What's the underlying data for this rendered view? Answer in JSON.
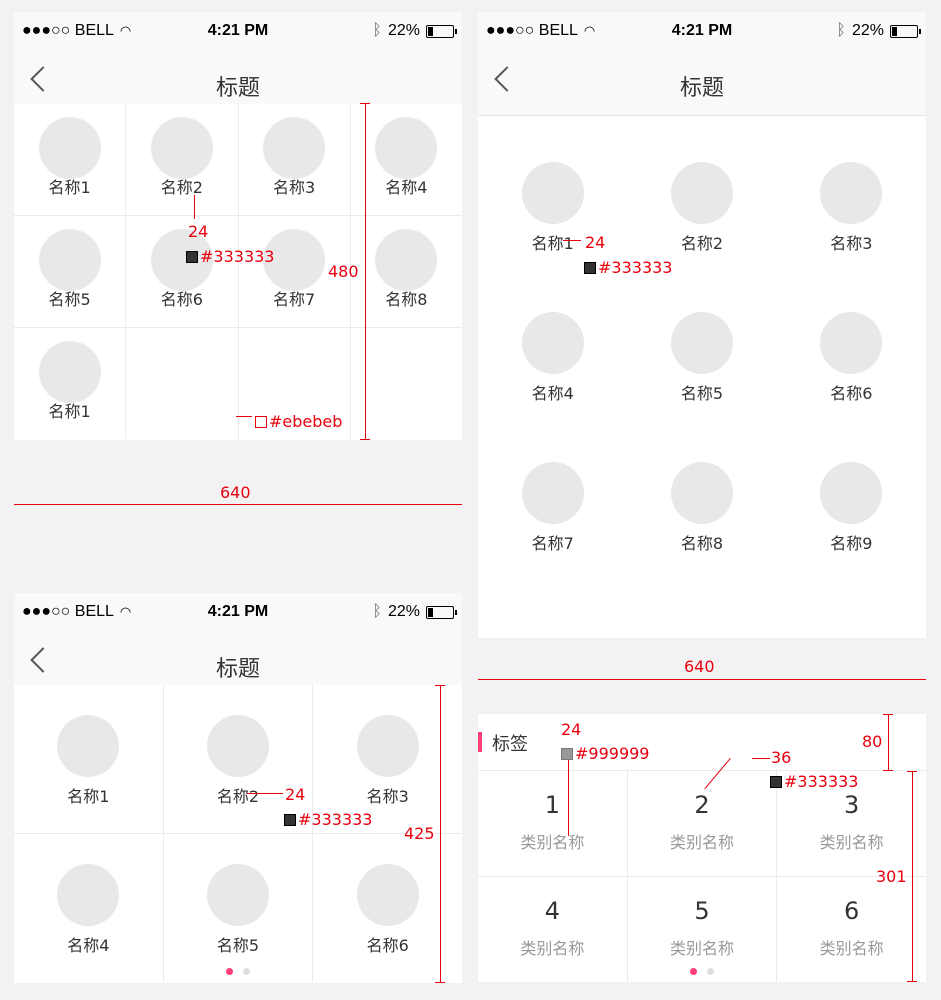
{
  "status": {
    "carrier": "●●●○○ BELL",
    "time": "4:21 PM",
    "battery": "22%",
    "battery_level": 0.22
  },
  "nav": {
    "title": "标题"
  },
  "panel_a": {
    "items": [
      "名称1",
      "名称2",
      "名称3",
      "名称4",
      "名称5",
      "名称6",
      "名称7",
      "名称8",
      "名称1"
    ],
    "ann": {
      "font": "24",
      "color": "#333333",
      "height": "480",
      "border": "#ebebeb",
      "width": "640"
    }
  },
  "panel_b": {
    "items": [
      "名称1",
      "名称2",
      "名称3",
      "名称4",
      "名称5",
      "名称6",
      "名称7",
      "名称8",
      "名称9"
    ],
    "ann": {
      "font": "24",
      "color": "#333333",
      "width": "640"
    }
  },
  "panel_c": {
    "items": [
      "名称1",
      "名称2",
      "名称3",
      "名称4",
      "名称5",
      "名称6"
    ],
    "ann": {
      "font": "24",
      "color": "#333333",
      "height": "425"
    },
    "page_dots": {
      "count": 2,
      "active": 0
    }
  },
  "panel_d": {
    "tag_label": "标签",
    "numbers": [
      "1",
      "2",
      "3",
      "4",
      "5",
      "6"
    ],
    "category": "类别名称",
    "ann": {
      "font_small": "24",
      "color_gray": "#999999",
      "font_large": "36",
      "color_dark": "#333333",
      "tag_height": "80",
      "grid_height": "301"
    },
    "page_dots": {
      "count": 2,
      "active": 0
    }
  },
  "colors": {
    "annotation": "#e8000e",
    "accent": "#ff3d77",
    "dot_inactive": "#dddddd"
  }
}
